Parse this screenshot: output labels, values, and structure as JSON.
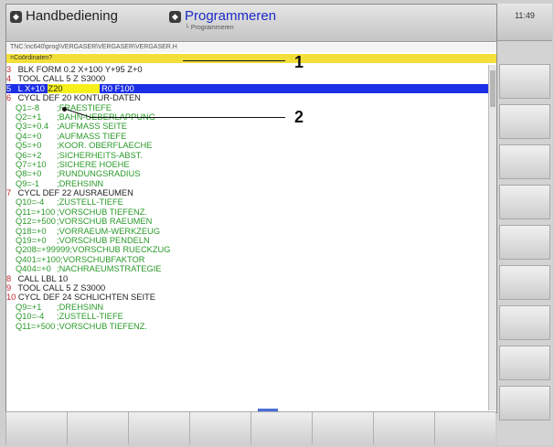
{
  "header": {
    "left_mode_label": "Handbediening",
    "right_mode_label": "Programmeren",
    "right_mode_sub": "Programmeren",
    "clock": "11:49"
  },
  "path_bar": "TNC:\\nc640\\prog\\VERGASER\\VERGASER\\VERGASER.H",
  "input_prompt": "=Coördinaten?",
  "program_lines": [
    {
      "n": "3",
      "text": "BLK FORM 0.2 X+100 Y+95 Z+0"
    },
    {
      "n": "4",
      "text": "TOOL CALL 5 Z S3000"
    },
    {
      "n": "5",
      "text": "L X+10",
      "hl": "Z20",
      "rest": "R0 F100",
      "selected": true
    },
    {
      "n": "6",
      "text": "CYCL DEF 20 KONTUR-DATEN"
    },
    {
      "p": "Q1=-8",
      "c": ";FRAESTIEFE"
    },
    {
      "p": "Q2=+1",
      "c": ";BAHN-UEBERLAPPUNG"
    },
    {
      "p": "Q3=+0.4",
      "c": ";AUFMASS SEITE"
    },
    {
      "p": "Q4=+0",
      "c": ";AUFMASS TIEFE"
    },
    {
      "p": "Q5=+0",
      "c": ";KOOR. OBERFLAECHE"
    },
    {
      "p": "Q6=+2",
      "c": ";SICHERHEITS-ABST."
    },
    {
      "p": "Q7=+10",
      "c": ";SICHERE HOEHE"
    },
    {
      "p": "Q8=+0",
      "c": ";RUNDUNGSRADIUS"
    },
    {
      "p": "Q9=-1",
      "c": ";DREHSINN"
    },
    {
      "n": "7",
      "text": "CYCL DEF 22 AUSRAEUMEN"
    },
    {
      "p": "Q10=-4",
      "c": ";ZUSTELL-TIEFE"
    },
    {
      "p": "Q11=+100",
      "c": ";VORSCHUB TIEFENZ."
    },
    {
      "p": "Q12=+500",
      "c": ";VORSCHUB RAEUMEN"
    },
    {
      "p": "Q18=+0",
      "c": ";VORRAEUM-WERKZEUG"
    },
    {
      "p": "Q19=+0",
      "c": ";VORSCHUB PENDELN"
    },
    {
      "p": "Q208=+99999",
      "c": ";VORSCHUB RUECKZUG"
    },
    {
      "p": "Q401=+100",
      "c": ";VORSCHUBFAKTOR"
    },
    {
      "p": "Q404=+0",
      "c": ";NACHRAEUMSTRATEGIE"
    },
    {
      "n": "8",
      "text": "CALL LBL 10"
    },
    {
      "n": "9",
      "text": "TOOL CALL 5 Z S3000"
    },
    {
      "n": "10",
      "text": "CYCL DEF 24 SCHLICHTEN SEITE"
    },
    {
      "p": "Q9=+1",
      "c": ";DREHSINN"
    },
    {
      "p": "Q10=-4",
      "c": ";ZUSTELL-TIEFE"
    },
    {
      "p": "Q11=+500",
      "c": ";VORSCHUB TIEFENZ."
    }
  ],
  "callouts": [
    "1",
    "2"
  ],
  "colors": {
    "selection": "#1c2fe6",
    "highlight": "#f6f11a",
    "input_bar": "#f3df3a",
    "line_number": "#c0242d",
    "param_text": "#2a9a2a",
    "mode_active": "#1a2bc8"
  }
}
